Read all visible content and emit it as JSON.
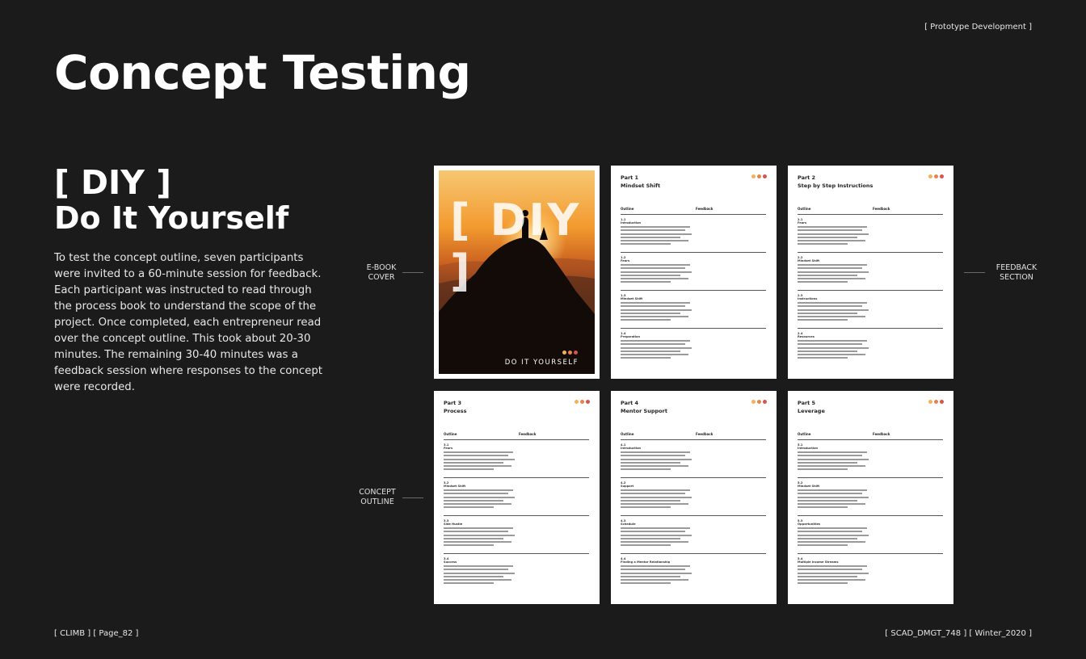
{
  "header": {
    "tag": "[ Prototype Development ]",
    "title": "Concept Testing"
  },
  "section": {
    "bracket": "[ DIY ]",
    "name": "Do It Yourself",
    "body": "To test the concept outline, seven participants were invited to a 60-minute session for feedback. Each participant was instructed to read through the process book to understand the scope of the project. Once completed, each entrepreneur read over the concept outline. This took about 20-30 minutes. The remaining 30-40 minutes was a feedback session where responses to the concept were recorded."
  },
  "labels": {
    "ebook_line1": "E-BOOK",
    "ebook_line2": "COVER",
    "feedback_line1": "FEEDBACK",
    "feedback_line2": "SECTION",
    "concept_line1": "CONCEPT",
    "concept_line2": "OUTLINE"
  },
  "cover": {
    "word": "[ DIY ]",
    "subtitle": "DO IT YOURSELF"
  },
  "colors": {
    "dot1": "#f0b35a",
    "dot2": "#e8834b",
    "dot3": "#d9534f",
    "background": "#1b1b1b"
  },
  "columns": {
    "outline": "Outline",
    "feedback": "Feedback"
  },
  "pages": [
    {
      "part": "Part 1",
      "name": "Mindset Shift",
      "sections": [
        {
          "num": "1.1",
          "title": "Introduction"
        },
        {
          "num": "1.2",
          "title": "Fears"
        },
        {
          "num": "1.3",
          "title": "Mindset Shift"
        },
        {
          "num": "1.4",
          "title": "Preparation"
        }
      ]
    },
    {
      "part": "Part 2",
      "name": "Step by Step Instructions",
      "sections": [
        {
          "num": "2.1",
          "title": "Fears"
        },
        {
          "num": "2.2",
          "title": "Mindset Shift"
        },
        {
          "num": "2.3",
          "title": "Instructions"
        },
        {
          "num": "2.4",
          "title": "Resources"
        }
      ]
    },
    {
      "part": "Part 3",
      "name": "Process",
      "sections": [
        {
          "num": "3.1",
          "title": "Fears"
        },
        {
          "num": "3.2",
          "title": "Mindset Shift"
        },
        {
          "num": "3.3",
          "title": "Side Hustle"
        },
        {
          "num": "3.4",
          "title": "Success"
        }
      ]
    },
    {
      "part": "Part 4",
      "name": "Mentor Support",
      "sections": [
        {
          "num": "4.1",
          "title": "Introduction"
        },
        {
          "num": "4.2",
          "title": "Support"
        },
        {
          "num": "4.3",
          "title": "Schedule"
        },
        {
          "num": "4.4",
          "title": "Finding a Mentor Relationship"
        }
      ]
    },
    {
      "part": "Part 5",
      "name": "Leverage",
      "sections": [
        {
          "num": "5.1",
          "title": "Introduction"
        },
        {
          "num": "5.2",
          "title": "Mindset Shift"
        },
        {
          "num": "5.3",
          "title": "Opportunities"
        },
        {
          "num": "5.4",
          "title": "Multiple Income Streams"
        }
      ]
    }
  ],
  "footer": {
    "left": "[ CLIMB ] [ Page_82 ]",
    "right": "[ SCAD_DMGT_748 ] [ Winter_2020 ]"
  }
}
